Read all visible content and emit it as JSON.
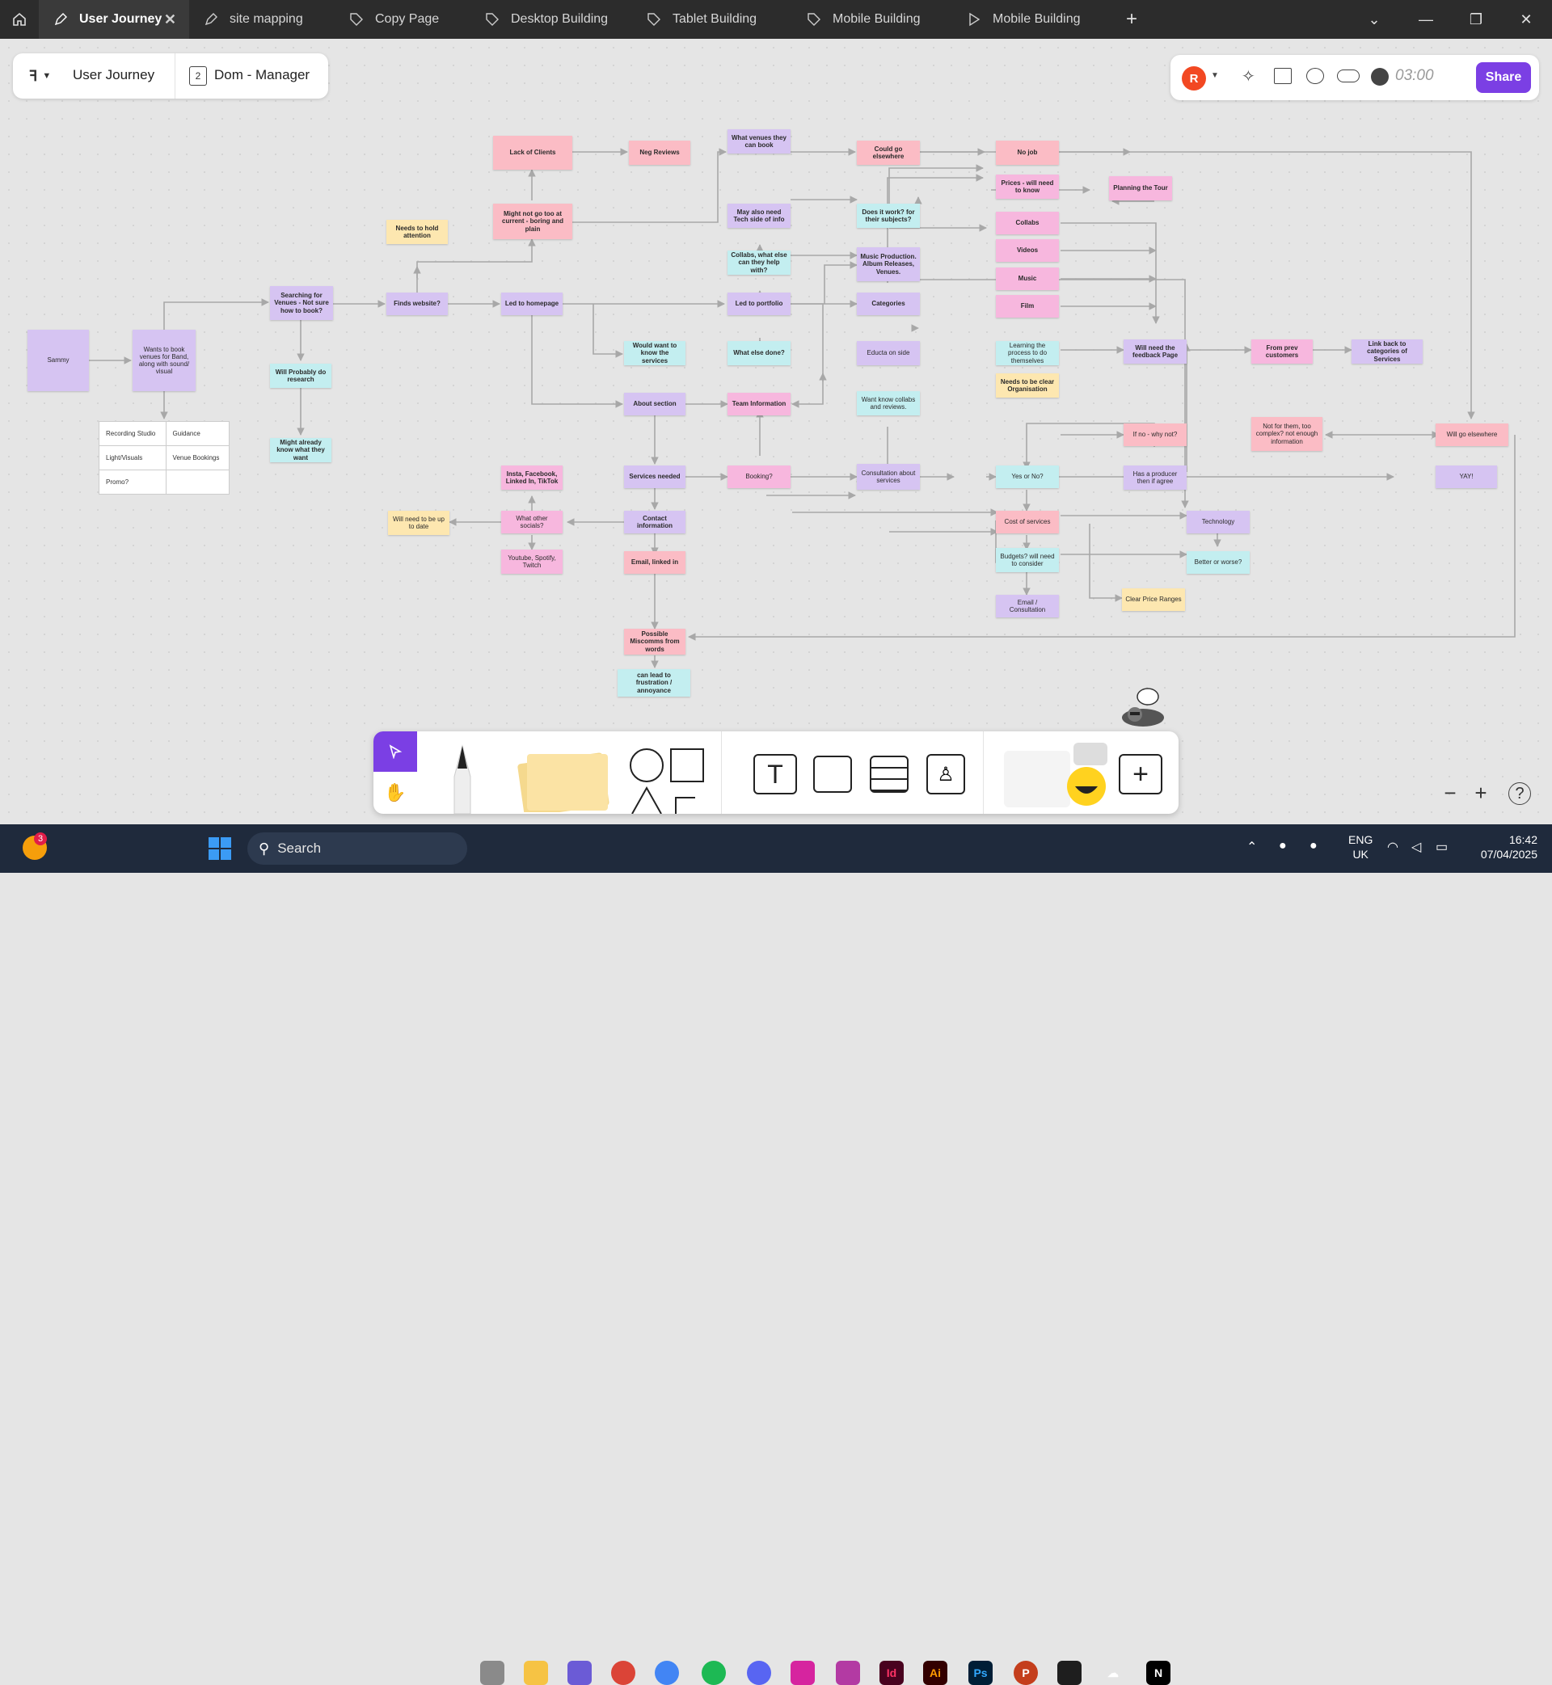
{
  "tabs": [
    {
      "label": "User Journey",
      "active": true
    },
    {
      "label": "site mapping"
    },
    {
      "label": "Copy Page"
    },
    {
      "label": "Desktop Building"
    },
    {
      "label": "Tablet Building"
    },
    {
      "label": "Mobile Building"
    },
    {
      "label": "Mobile Building"
    }
  ],
  "header": {
    "file_name": "User Journey",
    "page_number": "2",
    "page_name": "Dom - Manager",
    "avatar_letter": "R",
    "timer": "03:00",
    "share_label": "Share"
  },
  "table": [
    [
      "Recording Studio",
      "Guidance"
    ],
    [
      "Light/Visuals",
      "Venue Bookings"
    ],
    [
      "Promo?",
      ""
    ]
  ],
  "nodes": {
    "sammy": "Sammy",
    "wants": "Wants to book venues for Band, along with sound/ visual",
    "searching": "Searching for Venues - Not sure how to book?",
    "probably": "Will Probably  do research",
    "already": "Might already know what they want",
    "finds": "Finds website?",
    "hold": "Needs to hold attention",
    "led_home": "Led to homepage",
    "might_not": "Might not go too at current - boring and  plain",
    "lack": "Lack of Clients",
    "neg": "Neg Reviews",
    "would_want": "Would want to know the services",
    "about": "About  section",
    "services_needed": "Services needed",
    "insta": "Insta, Facebook, Linked In, TikTok",
    "other_socials": "What other socials?",
    "up_to_date": "Will need to be up to date",
    "youtube": "Youtube, Spotify, Twitch",
    "contact": "Contact information",
    "email_linked": "Email, linked in",
    "miscomms": "Possible Miscomms from words",
    "frustration": "can lead to frustration / annoyance",
    "venues": "What venues they can book",
    "tech": "May also need Tech side of info",
    "collabs_else": "Collabs, what else can they help with?",
    "portfolio": "Led to portfolio",
    "what_else": "What else done?",
    "team": "Team Information",
    "booking": "Booking?",
    "could_go": "Could go elsewhere",
    "does_work": "Does it work? for their subjects?",
    "music_prod": "Music Production. Album Releases, Venues.",
    "categories": "Categories",
    "educta": "Educta on side",
    "want_know": "Want know collabs and reviews.",
    "consultation": "Consultation about services",
    "no_job": "No job",
    "prices": "Prices - will need to know",
    "collabs": "Collabs",
    "videos": "Videos",
    "music": "Music",
    "film": "Film",
    "learning": "Learning the process to do themselves",
    "clear_org": "Needs to be clear Organisation",
    "yes_no": "Yes or No?",
    "cost": "Cost of services",
    "budgets": "Budgets? will need to consider",
    "email_consult": "Email / Consultation",
    "planning": "Planning the Tour",
    "feedback": "Will need the feedback Page",
    "if_no": "If no - why not?",
    "producer": "Has a producer then if agree",
    "technology": "Technology",
    "better": "Better or worse?",
    "price_ranges": "Clear Price Ranges",
    "prev": "From prev customers",
    "link_back": "Link back to categories of Services",
    "not_for": "Not for them, too complex? not enough information",
    "elsewhere": "Will go elsewhere",
    "yay": "YAY!"
  },
  "toolbar_text_tool": "T",
  "notification_count": "3",
  "taskbar": {
    "search_placeholder": "Search",
    "lang": "ENG",
    "region": "UK",
    "time": "16:42",
    "date": "07/04/2025"
  },
  "colors": {
    "pink": "#fbbcc5",
    "purple": "#d6c4f2",
    "cyan": "#c3eef0",
    "yellow": "#fde7b0",
    "magenta": "#f7b7de",
    "share": "#7b3fe4",
    "avatar": "#f24822"
  }
}
